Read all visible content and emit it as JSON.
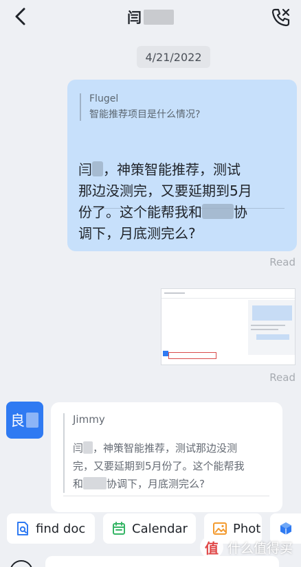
{
  "header": {
    "title_visible": "闫",
    "back_icon": "chevron-left-icon",
    "call_icon": "phone-call-icon"
  },
  "date_label": "4/21/2022",
  "outgoing": {
    "quote_author": "Flugel",
    "quote_text": "智能推荐项目是什么情况?",
    "line1_prefix": "闫",
    "line1_suffix": "，神策智能推荐，测试",
    "line2": "那边没测完，又要延期到5月",
    "line3_prefix": "份了。这个能帮我和",
    "line3_suffix": "协",
    "line4": "调下，月底测完么?",
    "status": "Read"
  },
  "image_status": "Read",
  "incoming": {
    "avatar_char": "良",
    "quote_author": "Jimmy",
    "line1_prefix": "闫",
    "line1_suffix": "，神策智能推荐，测试那边没测",
    "line2": "完，又要延期到5月份了。这个能帮我",
    "line3_prefix": "和",
    "line3_suffix": "协调下，月底测完么?"
  },
  "chips": [
    {
      "label": "find doc",
      "icon": "doc-search-icon",
      "color": "#2f7af2"
    },
    {
      "label": "Calendar",
      "icon": "calendar-icon",
      "color": "#35b565"
    },
    {
      "label": "Phot",
      "icon": "photo-icon",
      "color": "#f39a2e"
    }
  ],
  "watermark": {
    "text": "什么值得买",
    "logo": "值"
  },
  "colors": {
    "outgoing_bubble": "#c7e0fb",
    "accent": "#2f7af2",
    "background": "#eef0f4"
  }
}
